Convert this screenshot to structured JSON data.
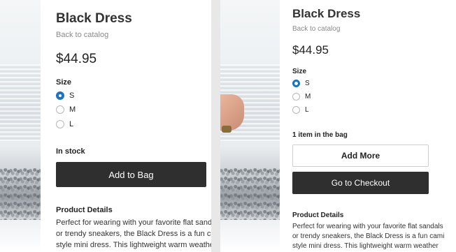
{
  "left": {
    "title": "Black Dress",
    "back_link": "Back to catalog",
    "price": "$44.95",
    "size_label": "Size",
    "sizes": [
      {
        "label": "S",
        "selected": true
      },
      {
        "label": "M",
        "selected": false
      },
      {
        "label": "L",
        "selected": false
      }
    ],
    "stock_status": "In stock",
    "add_to_bag": "Add to Bag",
    "details_heading": "Product Details",
    "details_lines": [
      "Perfect for wearing with your favorite flat sandals",
      "or trendy sneakers, the Black Dress is a fun cami",
      "style mini dress. This lightweight warm weather"
    ]
  },
  "right": {
    "title": "Black Dress",
    "back_link": "Back to catalog",
    "price": "$44.95",
    "size_label": "Size",
    "sizes": [
      {
        "label": "S",
        "selected": true
      },
      {
        "label": "M",
        "selected": false
      },
      {
        "label": "L",
        "selected": false
      }
    ],
    "bag_status": "1 item in the bag",
    "add_more": "Add More",
    "checkout": "Go to Checkout",
    "details_heading": "Product Details",
    "details_lines": [
      "Perfect for wearing with your favorite flat sandals",
      "or trendy sneakers, the Black Dress is a fun cami",
      "style mini dress. This lightweight warm weather"
    ]
  },
  "colors": {
    "radio_selected": "#1a73c7",
    "button_dark": "#2f2f2f"
  }
}
